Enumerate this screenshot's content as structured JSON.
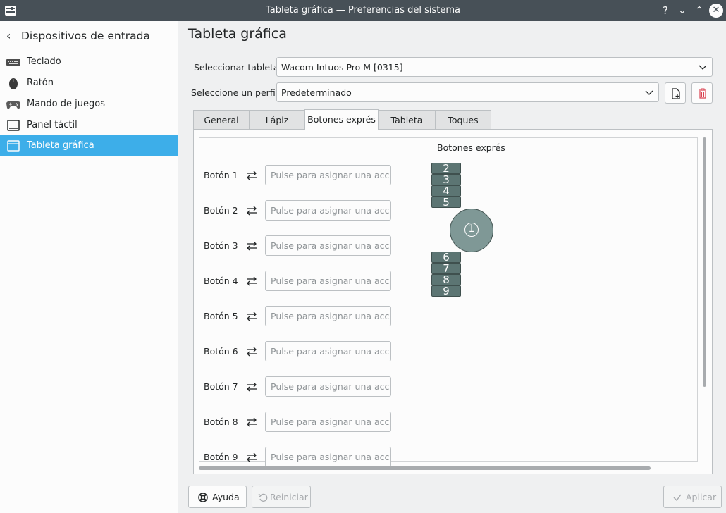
{
  "window": {
    "title": "Tableta gráfica — Preferencias del sistema",
    "help_glyph": "?",
    "min_glyph": "⌄",
    "max_glyph": "⌃",
    "close_glyph": "✕"
  },
  "sidebar": {
    "back_label": "Dispositivos de entrada",
    "back_glyph": "‹",
    "items": [
      {
        "label": "Teclado",
        "icon": "keyboard-icon"
      },
      {
        "label": "Ratón",
        "icon": "mouse-icon"
      },
      {
        "label": "Mando de juegos",
        "icon": "gamepad-icon"
      },
      {
        "label": "Panel táctil",
        "icon": "touchpad-icon"
      },
      {
        "label": "Tableta gráfica",
        "icon": "tablet-icon",
        "selected": true
      }
    ]
  },
  "main": {
    "title": "Tableta gráfica",
    "tablet_label": "Seleccionar tableta:",
    "tablet_value": "Wacom Intuos Pro M [0315]",
    "profile_label": "Seleccione un perfil:",
    "profile_value": "Predeterminado"
  },
  "tabs": [
    {
      "label": "General"
    },
    {
      "label": "Lápiz"
    },
    {
      "label": "Botones exprés",
      "active": true
    },
    {
      "label": "Tableta"
    },
    {
      "label": "Toques"
    }
  ],
  "express": {
    "title": "Botones exprés",
    "placeholder": "Pulse para asignar una acci...",
    "buttons": [
      "Botón 1",
      "Botón 2",
      "Botón 3",
      "Botón 4",
      "Botón 5",
      "Botón 6",
      "Botón 7",
      "Botón 8",
      "Botón 9"
    ],
    "diagram_keys_top": [
      "2",
      "3",
      "4",
      "5"
    ],
    "diagram_ring": "1",
    "diagram_keys_bottom": [
      "6",
      "7",
      "8",
      "9"
    ]
  },
  "footer": {
    "help_label": "Ayuda",
    "reset_label": "Reiniciar",
    "apply_label": "Aplicar"
  },
  "colors": {
    "accent": "#3daee9",
    "titlebar": "#475057",
    "express_key": "#5c7573"
  }
}
